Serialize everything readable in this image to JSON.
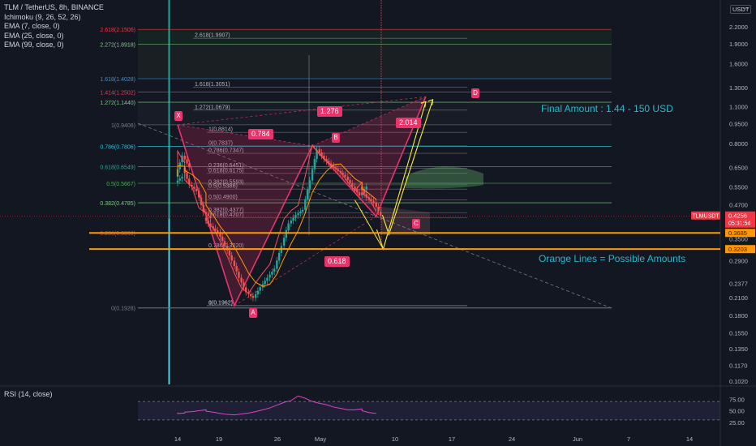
{
  "header": {
    "symbol_line": "TLM / TetherUS, 8h, BINANCE",
    "indicators": [
      "Ichimoku (9, 26, 52, 26)",
      "EMA (7, close, 0)",
      "EMA (25, close, 0)",
      "EMA (99, close, 0)"
    ],
    "rsi_label": "RSI (14, close)",
    "currency": "USDT",
    "menu_glyph": "…"
  },
  "annotations": {
    "final_amount": "Final Amount : 1.44 - 150 USD",
    "orange_lines": "Orange Lines = Possible Amounts"
  },
  "pattern": {
    "points": [
      "X",
      "A",
      "B",
      "C",
      "D"
    ],
    "ratios": [
      "0.784",
      "1.276",
      "2.014",
      "0.618"
    ]
  },
  "colors": {
    "background": "#131722",
    "bull_candle": "#26a69a",
    "bear_candle": "#ef5350",
    "pattern": "#e8336b",
    "orange_line": "#ff9800",
    "annotation_text": "#27b8cc",
    "projection": "#ffeb3b",
    "price_tag": "#f23645"
  },
  "price_badges": {
    "current": "0.4256",
    "current_symbol": "TLMUSDT",
    "countdown": "05:31:54",
    "line1": "0.3685",
    "line2": "0.3203"
  },
  "chart_data": {
    "type": "candlestick",
    "y_scale": "log",
    "y_ticks": [
      "2.2000",
      "1.9000",
      "1.6000",
      "1.3000",
      "1.1000",
      "0.9500",
      "0.8000",
      "0.6500",
      "0.5500",
      "0.4700",
      "0.4256",
      "0.3500",
      "0.2900",
      "0.2377",
      "0.2100",
      "0.1800",
      "0.1550",
      "0.1350",
      "0.1170",
      "0.1020"
    ],
    "y_tick_values": [
      2.2,
      1.9,
      1.6,
      1.3,
      1.1,
      0.95,
      0.8,
      0.65,
      0.55,
      0.47,
      0.4256,
      0.35,
      0.29,
      0.2377,
      0.21,
      0.18,
      0.155,
      0.135,
      0.117,
      0.102
    ],
    "x_ticks": [
      "14",
      "19",
      "26",
      "May",
      "10",
      "17",
      "24",
      "Jun",
      "7",
      "14"
    ],
    "ylim": [
      0.1,
      2.5
    ],
    "harmonic_points": [
      {
        "label": "X",
        "date": "Apr 14",
        "price": 0.9406
      },
      {
        "label": "A",
        "date": "Apr 22",
        "price": 0.1962
      },
      {
        "label": "B",
        "date": "May 3",
        "price": 0.7837
      },
      {
        "label": "C",
        "date": "May 12",
        "price": 0.4256
      },
      {
        "label": "D",
        "date": "May 19",
        "price": 1.2
      }
    ],
    "fib_sets": [
      {
        "name": "left",
        "levels": [
          {
            "text": "2.618(2.1506)",
            "value": 2.1506,
            "color": "#f23645"
          },
          {
            "text": "2.272(1.8918)",
            "value": 1.8918,
            "color": "#81c784"
          },
          {
            "text": "1.618(1.4028)",
            "value": 1.4028,
            "color": "#2196f3"
          },
          {
            "text": "1.414(1.2502)",
            "value": 1.2502,
            "color": "#f23645"
          },
          {
            "text": "1.272(1.1440)",
            "value": 1.144,
            "color": "#81c784"
          },
          {
            "text": "1(0.9406)",
            "value": 0.9406,
            "color": "#787b86"
          },
          {
            "text": "0.786(0.7806)",
            "value": 0.7806,
            "color": "#26c6da"
          },
          {
            "text": "0.618(0.6549)",
            "value": 0.6549,
            "color": "#26a69a"
          },
          {
            "text": "0.5(0.5667)",
            "value": 0.5667,
            "color": "#4caf50"
          },
          {
            "text": "0.382(0.4785)",
            "value": 0.4785,
            "color": "#81c784"
          },
          {
            "text": "0.236(0.3693)",
            "value": 0.3693,
            "color": "#f23645"
          },
          {
            "text": "0(0.1928)",
            "value": 0.1928,
            "color": "#787b86"
          }
        ]
      },
      {
        "name": "right",
        "levels": [
          {
            "text": "2.618(1.9907)",
            "value": 1.9907
          },
          {
            "text": "1.618(1.3051)",
            "value": 1.3051
          },
          {
            "text": "1.272(1.0679)",
            "value": 1.0679
          },
          {
            "text": "1(0.8814)",
            "value": 0.8814
          },
          {
            "text": "0(0.7837)",
            "value": 0.7837
          },
          {
            "text": "0.786(0.7347)",
            "value": 0.7347
          },
          {
            "text": "0.236(0.6451)",
            "value": 0.6451
          },
          {
            "text": "0.618(0.6175)",
            "value": 0.6175
          },
          {
            "text": "0.382(0.5593)",
            "value": 0.5593
          },
          {
            "text": "0.5(0.5386)",
            "value": 0.5386
          },
          {
            "text": "0.5(0.4900)",
            "value": 0.49
          },
          {
            "text": "0.382(0.4377)",
            "value": 0.4377
          },
          {
            "text": "0.618(0.4207)",
            "value": 0.4207
          },
          {
            "text": "0.786(0.3220)",
            "value": 0.322
          },
          {
            "text": "1(0.1962)",
            "value": 0.1962
          },
          {
            "text": "0(0.1962)",
            "value": 0.1962
          }
        ]
      }
    ],
    "orange_lines": [
      0.3685,
      0.3203
    ],
    "price_path": [
      {
        "date": "Apr 14",
        "price": 0.6
      },
      {
        "date": "Apr 14",
        "price": 0.72
      },
      {
        "date": "Apr 15",
        "price": 0.65
      },
      {
        "date": "Apr 15",
        "price": 0.56
      },
      {
        "date": "Apr 16",
        "price": 0.53
      },
      {
        "date": "Apr 17",
        "price": 0.44
      },
      {
        "date": "Apr 18",
        "price": 0.42
      },
      {
        "date": "Apr 18",
        "price": 0.39
      },
      {
        "date": "Apr 19",
        "price": 0.37
      },
      {
        "date": "Apr 20",
        "price": 0.33
      },
      {
        "date": "Apr 21",
        "price": 0.29
      },
      {
        "date": "Apr 22",
        "price": 0.25
      },
      {
        "date": "Apr 23",
        "price": 0.22
      },
      {
        "date": "Apr 24",
        "price": 0.21
      },
      {
        "date": "Apr 25",
        "price": 0.23
      },
      {
        "date": "Apr 26",
        "price": 0.25
      },
      {
        "date": "Apr 27",
        "price": 0.27
      },
      {
        "date": "Apr 28",
        "price": 0.33
      },
      {
        "date": "Apr 29",
        "price": 0.4
      },
      {
        "date": "Apr 30",
        "price": 0.43
      },
      {
        "date": "May 1",
        "price": 0.45
      },
      {
        "date": "May 2",
        "price": 0.58
      },
      {
        "date": "May 3",
        "price": 0.76
      },
      {
        "date": "May 4",
        "price": 0.7
      },
      {
        "date": "May 5",
        "price": 0.66
      },
      {
        "date": "May 6",
        "price": 0.63
      },
      {
        "date": "May 7",
        "price": 0.6
      },
      {
        "date": "May 8",
        "price": 0.55
      },
      {
        "date": "May 9",
        "price": 0.51
      },
      {
        "date": "May 10",
        "price": 0.55
      },
      {
        "date": "May 10",
        "price": 0.5
      },
      {
        "date": "May 11",
        "price": 0.48
      },
      {
        "date": "May 12",
        "price": 0.4256
      }
    ],
    "rsi": {
      "ylim": [
        0,
        100
      ],
      "ticks": [
        "75.00",
        "50.00",
        "25.00"
      ],
      "tick_values": [
        75,
        50,
        25
      ],
      "bands": [
        70,
        30
      ],
      "values": [
        46,
        44,
        45,
        47,
        48,
        50,
        52,
        49,
        47,
        44,
        42,
        41,
        43,
        45,
        48,
        52,
        56,
        62,
        68,
        72,
        82,
        77,
        70,
        66,
        63,
        58,
        55,
        52,
        52,
        54,
        50,
        46,
        44
      ]
    }
  }
}
